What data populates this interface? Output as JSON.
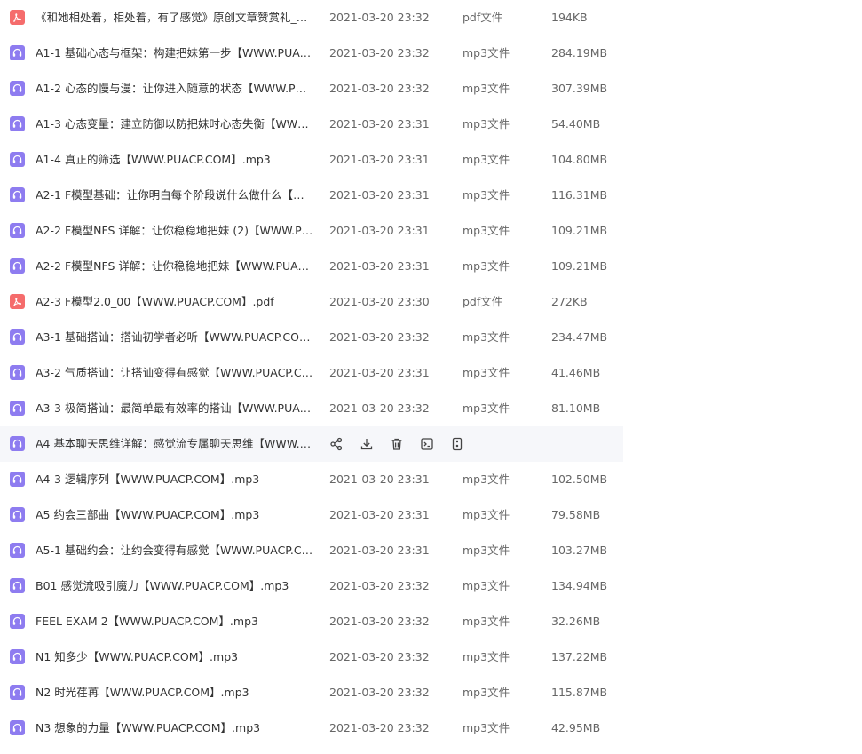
{
  "colors": {
    "pdf": "#f56c6c",
    "audio": "#8e7cf0",
    "hover_bg": "#f6f7fa"
  },
  "row_actions": [
    {
      "name": "share-icon"
    },
    {
      "name": "download-icon"
    },
    {
      "name": "delete-icon"
    },
    {
      "name": "rename-icon"
    },
    {
      "name": "more-icon"
    }
  ],
  "files": [
    {
      "icon": "pdf-icon",
      "name": "《和她相处着，相处着，有了感觉》原创文章赞赏礼_0【...",
      "date": "2021-03-20 23:32",
      "type": "pdf文件",
      "size": "194KB"
    },
    {
      "icon": "audio-icon",
      "name": "A1-1 基础心态与框架：构建把妹第一步【WWW.PUACP....",
      "date": "2021-03-20 23:32",
      "type": "mp3文件",
      "size": "284.19MB"
    },
    {
      "icon": "audio-icon",
      "name": "A1-2 心态的慢与漫：让你进入随意的状态【WWW.PUA...",
      "date": "2021-03-20 23:32",
      "type": "mp3文件",
      "size": "307.39MB"
    },
    {
      "icon": "audio-icon",
      "name": "A1-3 心态变量：建立防御以防把妹时心态失衡【WWW....",
      "date": "2021-03-20 23:31",
      "type": "mp3文件",
      "size": "54.40MB"
    },
    {
      "icon": "audio-icon",
      "name": "A1-4 真正的筛选【WWW.PUACP.COM】.mp3",
      "date": "2021-03-20 23:31",
      "type": "mp3文件",
      "size": "104.80MB"
    },
    {
      "icon": "audio-icon",
      "name": "A2-1 F模型基础：让你明白每个阶段说什么做什么【WW...",
      "date": "2021-03-20 23:31",
      "type": "mp3文件",
      "size": "116.31MB"
    },
    {
      "icon": "audio-icon",
      "name": "A2-2 F模型NFS 详解：让你稳稳地把妹 (2)【WWW.PUA...",
      "date": "2021-03-20 23:31",
      "type": "mp3文件",
      "size": "109.21MB"
    },
    {
      "icon": "audio-icon",
      "name": "A2-2 F模型NFS 详解：让你稳稳地把妹【WWW.PUACP....",
      "date": "2021-03-20 23:31",
      "type": "mp3文件",
      "size": "109.21MB"
    },
    {
      "icon": "pdf-icon",
      "name": "A2-3 F模型2.0_00【WWW.PUACP.COM】.pdf",
      "date": "2021-03-20 23:30",
      "type": "pdf文件",
      "size": "272KB"
    },
    {
      "icon": "audio-icon",
      "name": "A3-1 基础搭讪：搭讪初学者必听【WWW.PUACP.COM...",
      "date": "2021-03-20 23:32",
      "type": "mp3文件",
      "size": "234.47MB"
    },
    {
      "icon": "audio-icon",
      "name": "A3-2 气质搭讪：让搭讪变得有感觉【WWW.PUACP.CO...",
      "date": "2021-03-20 23:31",
      "type": "mp3文件",
      "size": "41.46MB"
    },
    {
      "icon": "audio-icon",
      "name": "A3-3 极简搭讪：最简单最有效率的搭讪【WWW.PUACP....",
      "date": "2021-03-20 23:32",
      "type": "mp3文件",
      "size": "81.10MB"
    },
    {
      "icon": "audio-icon",
      "name": "A4 基本聊天思维详解：感觉流专属聊天思维【WWW.PU...",
      "date": "",
      "type": "",
      "size": "",
      "hovered": true
    },
    {
      "icon": "audio-icon",
      "name": "A4-3 逻辑序列【WWW.PUACP.COM】.mp3",
      "date": "2021-03-20 23:31",
      "type": "mp3文件",
      "size": "102.50MB"
    },
    {
      "icon": "audio-icon",
      "name": "A5 约会三部曲【WWW.PUACP.COM】.mp3",
      "date": "2021-03-20 23:31",
      "type": "mp3文件",
      "size": "79.58MB"
    },
    {
      "icon": "audio-icon",
      "name": "A5-1 基础约会：让约会变得有感觉【WWW.PUACP.CO...",
      "date": "2021-03-20 23:31",
      "type": "mp3文件",
      "size": "103.27MB"
    },
    {
      "icon": "audio-icon",
      "name": "B01 感觉流吸引魔力【WWW.PUACP.COM】.mp3",
      "date": "2021-03-20 23:32",
      "type": "mp3文件",
      "size": "134.94MB"
    },
    {
      "icon": "audio-icon",
      "name": "FEEL EXAM 2【WWW.PUACP.COM】.mp3",
      "date": "2021-03-20 23:32",
      "type": "mp3文件",
      "size": "32.26MB"
    },
    {
      "icon": "audio-icon",
      "name": "N1 知多少【WWW.PUACP.COM】.mp3",
      "date": "2021-03-20 23:32",
      "type": "mp3文件",
      "size": "137.22MB"
    },
    {
      "icon": "audio-icon",
      "name": "N2 时光荏苒【WWW.PUACP.COM】.mp3",
      "date": "2021-03-20 23:32",
      "type": "mp3文件",
      "size": "115.87MB"
    },
    {
      "icon": "audio-icon",
      "name": "N3 想象的力量【WWW.PUACP.COM】.mp3",
      "date": "2021-03-20 23:32",
      "type": "mp3文件",
      "size": "42.95MB"
    }
  ]
}
